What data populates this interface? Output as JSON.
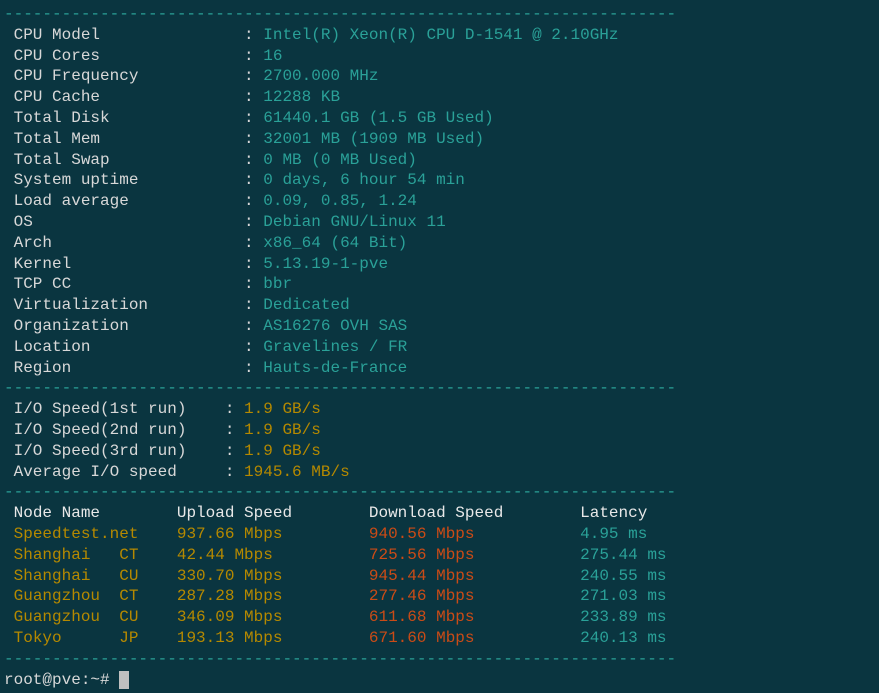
{
  "divider": "----------------------------------------------------------------------",
  "sysinfo": [
    {
      "label": "CPU Model",
      "value": "Intel(R) Xeon(R) CPU D-1541 @ 2.10GHz"
    },
    {
      "label": "CPU Cores",
      "value": "16"
    },
    {
      "label": "CPU Frequency",
      "value": "2700.000 MHz"
    },
    {
      "label": "CPU Cache",
      "value": "12288 KB"
    },
    {
      "label": "Total Disk",
      "value": "61440.1 GB (1.5 GB Used)"
    },
    {
      "label": "Total Mem",
      "value": "32001 MB (1909 MB Used)"
    },
    {
      "label": "Total Swap",
      "value": "0 MB (0 MB Used)"
    },
    {
      "label": "System uptime",
      "value": "0 days, 6 hour 54 min"
    },
    {
      "label": "Load average",
      "value": "0.09, 0.85, 1.24"
    },
    {
      "label": "OS",
      "value": "Debian GNU/Linux 11"
    },
    {
      "label": "Arch",
      "value": "x86_64 (64 Bit)"
    },
    {
      "label": "Kernel",
      "value": "5.13.19-1-pve"
    },
    {
      "label": "TCP CC",
      "value": "bbr"
    },
    {
      "label": "Virtualization",
      "value": "Dedicated"
    },
    {
      "label": "Organization",
      "value": "AS16276 OVH SAS"
    },
    {
      "label": "Location",
      "value": "Gravelines / FR"
    },
    {
      "label": "Region",
      "value": "Hauts-de-France"
    }
  ],
  "iospeed": [
    {
      "label": "I/O Speed(1st run)",
      "value": "1.9 GB/s"
    },
    {
      "label": "I/O Speed(2nd run)",
      "value": "1.9 GB/s"
    },
    {
      "label": "I/O Speed(3rd run)",
      "value": "1.9 GB/s"
    },
    {
      "label": "Average I/O speed",
      "value": "1945.6 MB/s"
    }
  ],
  "speedtest": {
    "headers": {
      "node": "Node Name",
      "upload": "Upload Speed",
      "download": "Download Speed",
      "latency": "Latency"
    },
    "rows": [
      {
        "node": "Speedtest.net",
        "upload": "937.66 Mbps",
        "download": "940.56 Mbps",
        "latency": "4.95 ms"
      },
      {
        "node": "Shanghai   CT",
        "upload": "42.44 Mbps",
        "download": "725.56 Mbps",
        "latency": "275.44 ms"
      },
      {
        "node": "Shanghai   CU",
        "upload": "330.70 Mbps",
        "download": "945.44 Mbps",
        "latency": "240.55 ms"
      },
      {
        "node": "Guangzhou  CT",
        "upload": "287.28 Mbps",
        "download": "277.46 Mbps",
        "latency": "271.03 ms"
      },
      {
        "node": "Guangzhou  CU",
        "upload": "346.09 Mbps",
        "download": "611.68 Mbps",
        "latency": "233.89 ms"
      },
      {
        "node": "Tokyo      JP",
        "upload": "193.13 Mbps",
        "download": "671.60 Mbps",
        "latency": "240.13 ms"
      }
    ]
  },
  "prompt": "root@pve:~# "
}
